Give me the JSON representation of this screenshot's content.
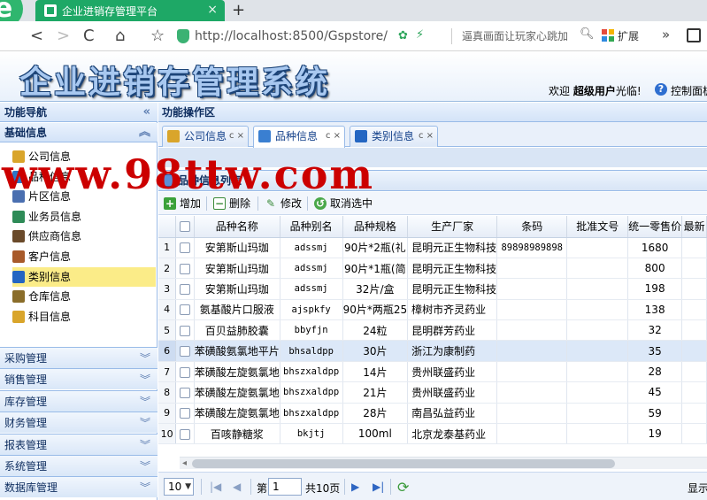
{
  "browser": {
    "tab_title": "企业进销存管理平台",
    "tab_close": "×",
    "new_tab": "+",
    "logo_letter": "e",
    "nav": {
      "back": "<",
      "forward": ">",
      "reload": "C",
      "home": "⌂",
      "star": "☆"
    },
    "url": "http://localhost:8500/Gspstore/",
    "search_hint": "逼真画面让玩家心跳加",
    "extensions_label": "扩展",
    "more": "»",
    "colors": {
      "tab": "#1ea866",
      "url_shield": "#3bb273"
    }
  },
  "app": {
    "title": "企业进销存管理系统",
    "welcome_prefix": "欢迎",
    "welcome_user": "超级用户",
    "welcome_suffix": "光临!",
    "help_icon": "?",
    "control_panel": "控制面板"
  },
  "sidebar": {
    "header": "功能导航",
    "collapse_icon": "«",
    "section_title": "基础信息",
    "section_icon": "︽",
    "items": [
      {
        "label": "公司信息",
        "icon": "company-icon",
        "color": "#d9a52b"
      },
      {
        "label": "品种信息",
        "icon": "product-icon",
        "color": "#2d76c9"
      },
      {
        "label": "片区信息",
        "icon": "region-icon",
        "color": "#4a6fb0"
      },
      {
        "label": "业务员信息",
        "icon": "salesman-icon",
        "color": "#2e8b57"
      },
      {
        "label": "供应商信息",
        "icon": "supplier-icon",
        "color": "#6a4a2a"
      },
      {
        "label": "客户信息",
        "icon": "customer-icon",
        "color": "#a85a2a"
      },
      {
        "label": "类别信息",
        "icon": "category-icon",
        "color": "#2466c2"
      },
      {
        "label": "仓库信息",
        "icon": "warehouse-icon",
        "color": "#8a6d2a"
      },
      {
        "label": "科目信息",
        "icon": "subject-icon",
        "color": "#d9a52b"
      }
    ],
    "selected_index": 6,
    "accordions": [
      {
        "label": "采购管理"
      },
      {
        "label": "销售管理"
      },
      {
        "label": "库存管理"
      },
      {
        "label": "财务管理"
      },
      {
        "label": "报表管理"
      },
      {
        "label": "系统管理"
      },
      {
        "label": "数据库管理"
      }
    ],
    "accordion_icon": "︾"
  },
  "main": {
    "header": "功能操作区",
    "tabs": [
      {
        "label": "公司信息",
        "ctl": "c ×",
        "color": "#d9a52b"
      },
      {
        "label": "品种信息",
        "ctl": "c ×",
        "color": "#3a7fd1"
      },
      {
        "label": "类别信息",
        "ctl": "c ×",
        "color": "#2466c2"
      }
    ],
    "active_tab": 1,
    "grid_title": "品种信息列表",
    "toolbar": {
      "add": "增加",
      "delete": "删除",
      "edit": "修改",
      "cancel_select": "取消选中"
    },
    "table": {
      "columns": [
        "品种名称",
        "品种别名",
        "品种规格",
        "生产厂家",
        "条码",
        "批准文号",
        "统一零售价",
        "最新"
      ],
      "rows": [
        {
          "n": "1",
          "name": "安第斯山玛珈",
          "alias": "adssmj",
          "spec": "90片*2瓶(礼",
          "maker": "昆明元正生物科技",
          "barcode": "89898989898",
          "approval": "",
          "price": "1680"
        },
        {
          "n": "2",
          "name": "安第斯山玛珈",
          "alias": "adssmj",
          "spec": "90片*1瓶(简",
          "maker": "昆明元正生物科技",
          "barcode": "",
          "approval": "",
          "price": "800"
        },
        {
          "n": "3",
          "name": "安第斯山玛珈",
          "alias": "adssmj",
          "spec": "32片/盒",
          "maker": "昆明元正生物科技",
          "barcode": "",
          "approval": "",
          "price": "198"
        },
        {
          "n": "4",
          "name": "氨基酸片口服液",
          "alias": "ajspkfy",
          "spec": "90片*两瓶25",
          "maker": "樟树市齐灵药业",
          "barcode": "",
          "approval": "",
          "price": "138"
        },
        {
          "n": "5",
          "name": "百贝益肺胶囊",
          "alias": "bbyfjn",
          "spec": "24粒",
          "maker": "昆明群芳药业",
          "barcode": "",
          "approval": "",
          "price": "32"
        },
        {
          "n": "6",
          "name": "苯磺酸氨氯地平片",
          "alias": "bhsaldpp",
          "spec": "30片",
          "maker": "浙江为康制药",
          "barcode": "",
          "approval": "",
          "price": "35"
        },
        {
          "n": "7",
          "name": "苯磺酸左旋氨氯地",
          "alias": "bhszxaldpp",
          "spec": "14片",
          "maker": "贵州联盛药业",
          "barcode": "",
          "approval": "",
          "price": "28"
        },
        {
          "n": "8",
          "name": "苯磺酸左旋氨氯地",
          "alias": "bhszxaldpp",
          "spec": "21片",
          "maker": "贵州联盛药业",
          "barcode": "",
          "approval": "",
          "price": "45"
        },
        {
          "n": "9",
          "name": "苯磺酸左旋氨氯地",
          "alias": "bhszxaldpp",
          "spec": "28片",
          "maker": "南昌弘益药业",
          "barcode": "",
          "approval": "",
          "price": "59"
        },
        {
          "n": "10",
          "name": "百咳静糖浆",
          "alias": "bkjtj",
          "spec": "100ml",
          "maker": "北京龙泰基药业",
          "barcode": "",
          "approval": "",
          "price": "19"
        }
      ],
      "highlight_row": 5
    },
    "pager": {
      "page_size": "10",
      "page_label": "第",
      "page_value": "1",
      "page_total": "共10页",
      "display": "显示"
    }
  },
  "watermark": "www.98ttw.com"
}
